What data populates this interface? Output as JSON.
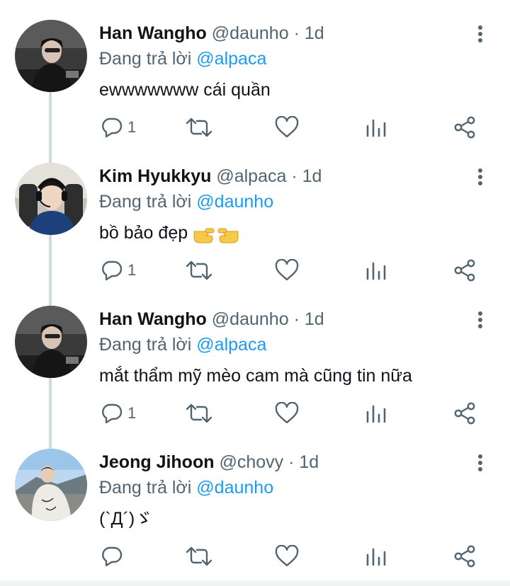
{
  "tweets": [
    {
      "name": "Han Wangho",
      "handle": "@daunho",
      "sep": "·",
      "time": "1d",
      "reply_prefix": "Đang trả lời",
      "reply_mention": "@alpaca",
      "text": "ewwwwwww cái quần",
      "reply_count": "1",
      "avatar_icon": "avatar-photo"
    },
    {
      "name": "Kim Hyukkyu",
      "handle": "@alpaca",
      "sep": "·",
      "time": "1d",
      "reply_prefix": "Đang trả lời",
      "reply_mention": "@daunho",
      "text": "bồ bảo đẹp",
      "reply_count": "1",
      "avatar_icon": "avatar-photo"
    },
    {
      "name": "Han Wangho",
      "handle": "@daunho",
      "sep": "·",
      "time": "1d",
      "reply_prefix": "Đang trả lời",
      "reply_mention": "@alpaca",
      "text": "mắt thẩm mỹ mèo cam mà cũng tin nữa",
      "reply_count": "1",
      "avatar_icon": "avatar-photo"
    },
    {
      "name": "Jeong Jihoon",
      "handle": "@chovy",
      "sep": "·",
      "time": "1d",
      "reply_prefix": "Đang trả lời",
      "reply_mention": "@daunho",
      "text": "(`Д´)ゞ",
      "reply_count": "",
      "avatar_icon": "avatar-photo"
    }
  ],
  "colors": {
    "accent": "#1d9bf0",
    "secondary_text": "#536471",
    "thread_line": "#cfd9de"
  },
  "icons": [
    "reply-icon",
    "retweet-icon",
    "like-icon",
    "analytics-icon",
    "share-icon",
    "more-icon",
    "pointing-hands-emoji"
  ]
}
